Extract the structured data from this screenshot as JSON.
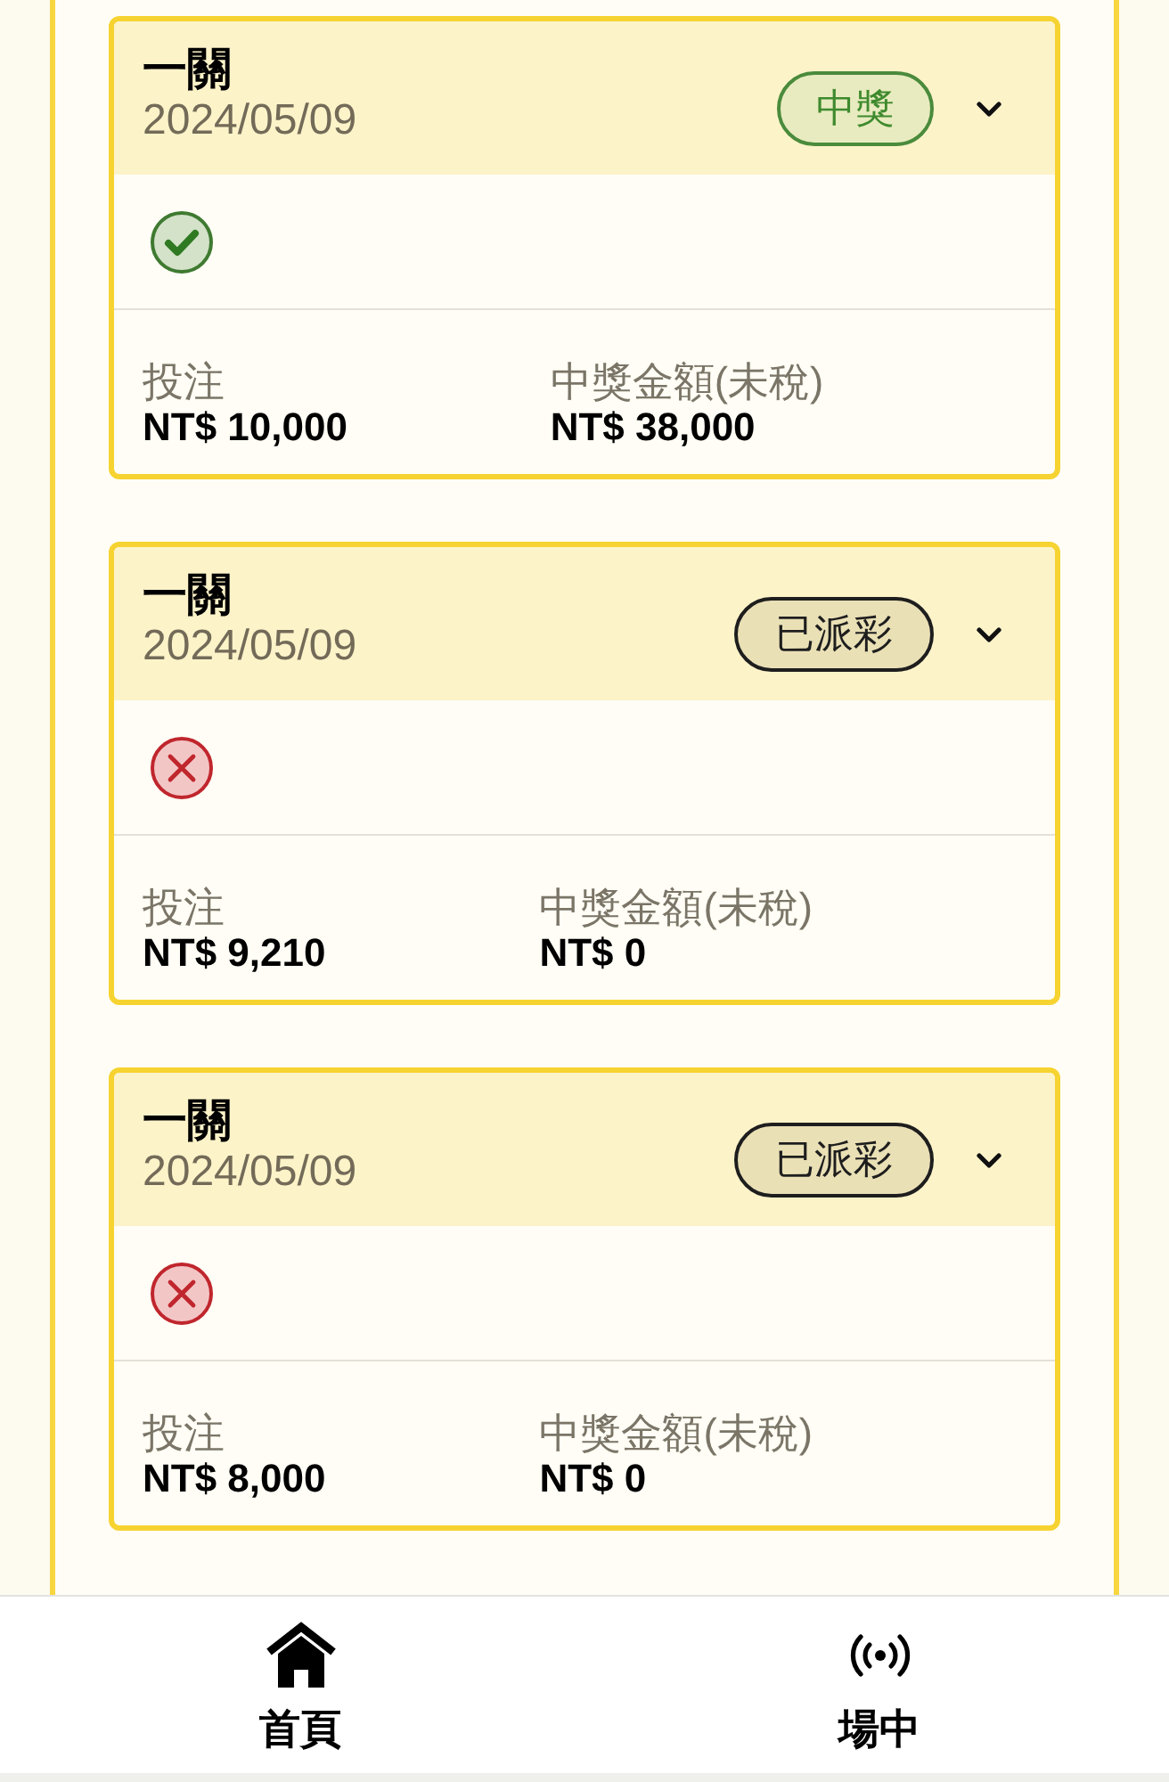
{
  "bets": [
    {
      "title": "一關",
      "date": "2024/05/09",
      "status": {
        "kind": "won",
        "label": "中獎"
      },
      "result": {
        "kind": "win"
      },
      "stake_label": "投注",
      "stake": "NT$ 10,000",
      "payout_label": "中獎金額(未稅)",
      "payout": "NT$ 38,000"
    },
    {
      "title": "一關",
      "date": "2024/05/09",
      "status": {
        "kind": "paid",
        "label": "已派彩"
      },
      "result": {
        "kind": "lose"
      },
      "stake_label": "投注",
      "stake": "NT$ 9,210",
      "payout_label": "中獎金額(未稅)",
      "payout": "NT$ 0"
    },
    {
      "title": "一關",
      "date": "2024/05/09",
      "status": {
        "kind": "paid",
        "label": "已派彩"
      },
      "result": {
        "kind": "lose"
      },
      "stake_label": "投注",
      "stake": "NT$ 8,000",
      "payout_label": "中獎金額(未稅)",
      "payout": "NT$ 0"
    }
  ],
  "bottom_nav": [
    {
      "kind": "home",
      "label": "首頁"
    },
    {
      "kind": "live",
      "label": "場中"
    }
  ]
}
